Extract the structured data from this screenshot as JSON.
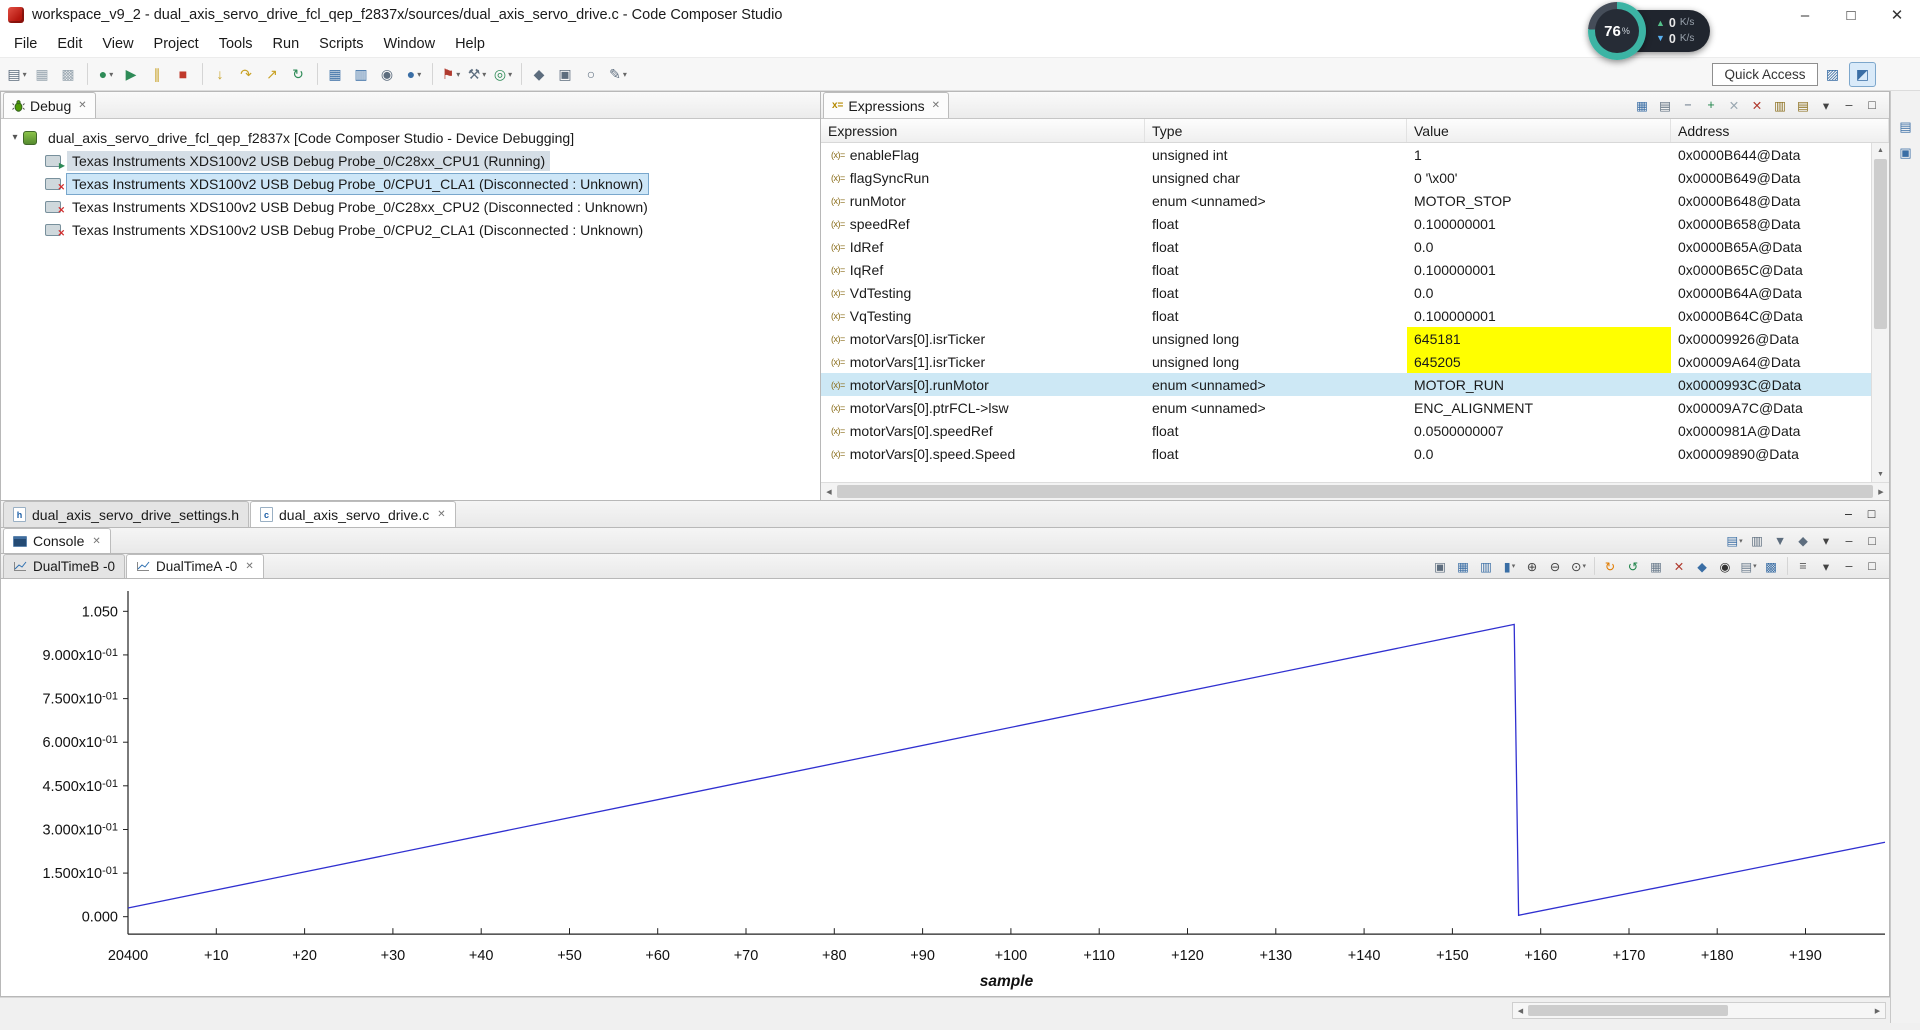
{
  "window": {
    "title": "workspace_v9_2 - dual_axis_servo_drive_fcl_qep_f2837x/sources/dual_axis_servo_drive.c - Code Composer Studio",
    "controls": {
      "minimize": "–",
      "maximize": "□",
      "close": "✕"
    }
  },
  "menubar": {
    "items": [
      {
        "label": "File",
        "name": "menu-file"
      },
      {
        "label": "Edit",
        "name": "menu-edit"
      },
      {
        "label": "View",
        "name": "menu-view"
      },
      {
        "label": "Project",
        "name": "menu-project"
      },
      {
        "label": "Tools",
        "name": "menu-tools"
      },
      {
        "label": "Run",
        "name": "menu-run"
      },
      {
        "label": "Scripts",
        "name": "menu-scripts"
      },
      {
        "label": "Window",
        "name": "menu-window"
      },
      {
        "label": "Help",
        "name": "menu-help"
      }
    ]
  },
  "toolbar": {
    "items": [
      {
        "name": "new-file-icon",
        "glyph": "▤",
        "color": "#5d6d7e",
        "dd": "▾"
      },
      {
        "name": "save-icon",
        "glyph": "▦",
        "color": "#9aa7b1"
      },
      {
        "name": "save-all-icon",
        "glyph": "▩",
        "color": "#9aa7b1"
      },
      {
        "name": "toolbar-separator",
        "kind": "sep",
        "ia": "false"
      },
      {
        "name": "debug-icon",
        "glyph": "●",
        "color": "#2e8b57",
        "dd": "▾"
      },
      {
        "name": "resume-icon",
        "glyph": "▶",
        "color": "#2e8b57"
      },
      {
        "name": "suspend-icon",
        "glyph": "∥",
        "color": "#c9a227"
      },
      {
        "name": "terminate-icon",
        "glyph": "■",
        "color": "#c0392b"
      },
      {
        "name": "toolbar-separator",
        "kind": "sep",
        "ia": "false"
      },
      {
        "name": "step-into-icon",
        "glyph": "↓",
        "color": "#c9a227"
      },
      {
        "name": "step-over-icon",
        "glyph": "↷",
        "color": "#c9a227"
      },
      {
        "name": "step-return-icon",
        "glyph": "↗",
        "color": "#c9a227"
      },
      {
        "name": "restart-icon",
        "glyph": "↻",
        "color": "#2e8b57"
      },
      {
        "name": "toolbar-separator",
        "kind": "sep",
        "ia": "false"
      },
      {
        "name": "memory-browser-icon",
        "glyph": "▦",
        "color": "#3a6ea5"
      },
      {
        "name": "registers-icon",
        "glyph": "▥",
        "color": "#3a6ea5"
      },
      {
        "name": "watch-icon",
        "glyph": "◉",
        "color": "#5d6d7e"
      },
      {
        "name": "breakpoints-icon",
        "glyph": "●",
        "color": "#3a6ea5",
        "dd": "▾"
      },
      {
        "name": "toolbar-separator",
        "kind": "sep",
        "ia": "false"
      },
      {
        "name": "flash-icon",
        "glyph": "⚑",
        "color": "#b03a2e",
        "dd": "▾"
      },
      {
        "name": "build-icon",
        "glyph": "⚒",
        "color": "#5d6d7e",
        "dd": "▾"
      },
      {
        "name": "target-config-icon",
        "glyph": "◎",
        "color": "#2e8b57",
        "dd": "▾"
      },
      {
        "name": "toolbar-separator",
        "kind": "sep",
        "ia": "false"
      },
      {
        "name": "pin-icon",
        "glyph": "◆",
        "color": "#5d6d7e"
      },
      {
        "name": "window-icon",
        "glyph": "▣",
        "color": "#5d6d7e"
      },
      {
        "name": "search-icon",
        "glyph": "○",
        "color": "#5d6d7e"
      },
      {
        "name": "edit-icon",
        "glyph": "✎",
        "color": "#5d6d7e",
        "dd": "▾"
      }
    ]
  },
  "perspective": {
    "quick_access": "Quick Access",
    "buttons": [
      {
        "name": "open-perspective-icon",
        "glyph": "▨",
        "ia": "true"
      },
      {
        "name": "debug-perspective-icon",
        "glyph": "◩",
        "active": "active",
        "ia": "true"
      }
    ]
  },
  "overlay": {
    "percent_value": "76",
    "percent_sign": "%",
    "up_rate": "0",
    "up_unit": "K/s",
    "down_rate": "0",
    "down_unit": "K/s"
  },
  "panel_controls": {
    "minimize": "–",
    "maximize": "□"
  },
  "debug_panel": {
    "tab": "Debug",
    "close": "✕",
    "expander": "▾",
    "tree": {
      "root": "dual_axis_servo_drive_fcl_qep_f2837x [Code Composer Studio - Device Debugging]",
      "children": [
        {
          "label": "Texas Instruments XDS100v2 USB Debug Probe_0/C28xx_CPU1 (Running)",
          "row_class": "sel-inactive",
          "icon_class": "running"
        },
        {
          "label": "Texas Instruments XDS100v2 USB Debug Probe_0/CPU1_CLA1 (Disconnected : Unknown)",
          "row_class": "sel-focus",
          "icon_class": "disc"
        },
        {
          "label": "Texas Instruments XDS100v2 USB Debug Probe_0/C28xx_CPU2 (Disconnected : Unknown)",
          "icon_class": "disc"
        },
        {
          "label": "Texas Instruments XDS100v2 USB Debug Probe_0/CPU2_CLA1 (Disconnected : Unknown)",
          "icon_class": "disc"
        }
      ]
    }
  },
  "expressions_panel": {
    "tab": "Expressions",
    "close": "✕",
    "columns": [
      "Expression",
      "Type",
      "Value",
      "Address"
    ],
    "toolbar": [
      {
        "name": "show-types-icon",
        "glyph": "▦",
        "color": "#3a6ea5"
      },
      {
        "name": "layout-icon",
        "glyph": "▤",
        "color": "#5d6d7e"
      },
      {
        "name": "collapse-all-icon",
        "glyph": "−",
        "color": "#5d6d7e"
      },
      {
        "name": "add-expression-icon",
        "glyph": "+",
        "color": "#1e8449"
      },
      {
        "name": "remove-expression-icon",
        "glyph": "✕",
        "color": "#9aa7b1"
      },
      {
        "name": "remove-all-icon",
        "glyph": "✕",
        "color": "#b03a2e"
      },
      {
        "name": "import-icon",
        "glyph": "▥",
        "color": "#8a6d1a"
      },
      {
        "name": "export-icon",
        "glyph": "▤",
        "color": "#8a6d1a"
      },
      {
        "name": "view-menu-icon",
        "glyph": "▾",
        "color": "#444"
      },
      {
        "name": "minimize-icon",
        "glyph": "–",
        "color": "#444"
      },
      {
        "name": "maximize-icon",
        "glyph": "□",
        "color": "#444"
      }
    ],
    "rows": [
      {
        "expression": "enableFlag",
        "type": "unsigned int",
        "value": "1",
        "address": "0x0000B644@Data"
      },
      {
        "expression": "flagSyncRun",
        "type": "unsigned char",
        "value": "0 '\\x00'",
        "address": "0x0000B649@Data"
      },
      {
        "expression": "runMotor",
        "type": "enum <unnamed>",
        "value": "MOTOR_STOP",
        "address": "0x0000B648@Data"
      },
      {
        "expression": "speedRef",
        "type": "float",
        "value": "0.100000001",
        "address": "0x0000B658@Data"
      },
      {
        "expression": "IdRef",
        "type": "float",
        "value": "0.0",
        "address": "0x0000B65A@Data"
      },
      {
        "expression": "IqRef",
        "type": "float",
        "value": "0.100000001",
        "address": "0x0000B65C@Data"
      },
      {
        "expression": "VdTesting",
        "type": "float",
        "value": "0.0",
        "address": "0x0000B64A@Data"
      },
      {
        "expression": "VqTesting",
        "type": "float",
        "value": "0.100000001",
        "address": "0x0000B64C@Data"
      },
      {
        "expression": "motorVars[0].isrTicker",
        "type": "unsigned long",
        "value": "645181",
        "address": "0x00009926@Data",
        "value_class": "changed"
      },
      {
        "expression": "motorVars[1].isrTicker",
        "type": "unsigned long",
        "value": "645205",
        "address": "0x00009A64@Data",
        "value_class": "changed"
      },
      {
        "expression": "motorVars[0].runMotor",
        "type": "enum <unnamed>",
        "value": "MOTOR_RUN",
        "address": "0x0000993C@Data",
        "row_class": "selected"
      },
      {
        "expression": "motorVars[0].ptrFCL->lsw",
        "type": "enum <unnamed>",
        "value": "ENC_ALIGNMENT",
        "address": "0x00009A7C@Data"
      },
      {
        "expression": "motorVars[0].speedRef",
        "type": "float",
        "value": "0.0500000007",
        "address": "0x0000981A@Data"
      },
      {
        "expression": "motorVars[0].speed.Speed",
        "type": "float",
        "value": "0.0",
        "address": "0x00009890@Data"
      }
    ]
  },
  "editor_tabs": {
    "tabs": [
      {
        "label": "dual_axis_servo_drive_settings.h",
        "ftype": "h"
      },
      {
        "label": "dual_axis_servo_drive.c",
        "ftype": "c",
        "close": "✕"
      }
    ]
  },
  "console_panel": {
    "tab": "Console",
    "close": "✕",
    "toolbar": [
      {
        "name": "open-console-icon",
        "glyph": "▤",
        "color": "#3a6ea5",
        "dd": "▾"
      },
      {
        "name": "clear-console-icon",
        "glyph": "▥",
        "color": "#5d6d7e"
      },
      {
        "name": "scroll-lock-icon",
        "glyph": "▼",
        "color": "#5d6d7e"
      },
      {
        "name": "pin-console-icon",
        "glyph": "◆",
        "color": "#5d6d7e"
      },
      {
        "name": "view-menu-icon",
        "glyph": "▾",
        "color": "#444"
      },
      {
        "name": "minimize-icon",
        "glyph": "–",
        "color": "#444"
      },
      {
        "name": "maximize-icon",
        "glyph": "□",
        "color": "#444"
      }
    ]
  },
  "graph_panel": {
    "tabs": [
      {
        "label": "DualTimeB -0"
      },
      {
        "label": "DualTimeA -0",
        "close": "✕"
      }
    ],
    "toolbar": [
      {
        "name": "export-graph-icon",
        "glyph": "▣",
        "color": "#5d6d7e"
      },
      {
        "name": "fit-view-icon",
        "glyph": "▦",
        "color": "#3a6ea5"
      },
      {
        "name": "axis-settings-icon",
        "glyph": "▥",
        "color": "#3a6ea5"
      },
      {
        "name": "magnitude-icon",
        "glyph": "▮",
        "color": "#3a6ea5",
        "dd": "▾"
      },
      {
        "name": "zoom-in-icon",
        "glyph": "⊕",
        "color": "#444"
      },
      {
        "name": "zoom-out-icon",
        "glyph": "⊖",
        "color": "#444"
      },
      {
        "name": "zoom-area-icon",
        "glyph": "⊙",
        "color": "#444",
        "dd": "▾"
      },
      {
        "name": "toolbar-separator",
        "kind": "sep",
        "ia": "false"
      },
      {
        "name": "refresh-graph-icon",
        "glyph": "↻",
        "color": "#e07b00"
      },
      {
        "name": "auto-scale-icon",
        "glyph": "↺",
        "color": "#1e8449"
      },
      {
        "name": "toggle-grid-icon",
        "glyph": "▦",
        "color": "#6a7b8c"
      },
      {
        "name": "clear-graph-icon",
        "glyph": "✕",
        "color": "#b03a2e"
      },
      {
        "name": "freeze-icon",
        "glyph": "◆",
        "color": "#3a6ea5"
      },
      {
        "name": "find-icon",
        "glyph": "◉",
        "color": "#333"
      },
      {
        "name": "properties-icon",
        "glyph": "▤",
        "color": "#6a7b8c",
        "dd": "▾"
      },
      {
        "name": "tile-graphs-icon",
        "glyph": "▩",
        "color": "#3a6ea5"
      },
      {
        "name": "toolbar-separator",
        "kind": "sep",
        "ia": "false"
      },
      {
        "name": "legend-icon",
        "glyph": "≡",
        "color": "#555"
      },
      {
        "name": "view-menu-icon",
        "glyph": "▾",
        "color": "#444"
      },
      {
        "name": "minimize-icon",
        "glyph": "–",
        "color": "#444"
      },
      {
        "name": "maximize-icon",
        "glyph": "□",
        "color": "#444"
      }
    ]
  },
  "right_strip": {
    "icons": [
      {
        "name": "restore-view-icon",
        "glyph": "▤",
        "ia": "true"
      },
      {
        "name": "fast-view-icon",
        "glyph": "▣",
        "ia": "true"
      }
    ]
  },
  "chart_data": {
    "type": "line",
    "title": "",
    "xlabel": "sample",
    "ylabel": "",
    "x_start": 20400,
    "x_end": 20599,
    "x_tick_interval": 10,
    "x_tick_labels": [
      "20400",
      "+10",
      "+20",
      "+30",
      "+40",
      "+50",
      "+60",
      "+70",
      "+80",
      "+90",
      "+100",
      "+110",
      "+120",
      "+130",
      "+140",
      "+150",
      "+160",
      "+170",
      "+180",
      "+190"
    ],
    "y_ticks": [
      {
        "v": 1.05,
        "label": "1.050"
      },
      {
        "v": 0.9,
        "label": "9.000x10-01"
      },
      {
        "v": 0.75,
        "label": "7.500x10-01"
      },
      {
        "v": 0.6,
        "label": "6.000x10-01"
      },
      {
        "v": 0.45,
        "label": "4.500x10-01"
      },
      {
        "v": 0.3,
        "label": "3.000x10-01"
      },
      {
        "v": 0.15,
        "label": "1.500x10-01"
      },
      {
        "v": 0.0,
        "label": "0.000"
      }
    ],
    "ylim": [
      -0.06,
      1.12
    ],
    "grid": false,
    "legend": false,
    "series": [
      {
        "name": "DualTimeA -0",
        "color": "#3030d0",
        "points": [
          [
            20400,
            0.03
          ],
          [
            20557,
            1.005
          ],
          [
            20557.5,
            0.005
          ],
          [
            20599,
            0.256
          ]
        ]
      }
    ]
  }
}
